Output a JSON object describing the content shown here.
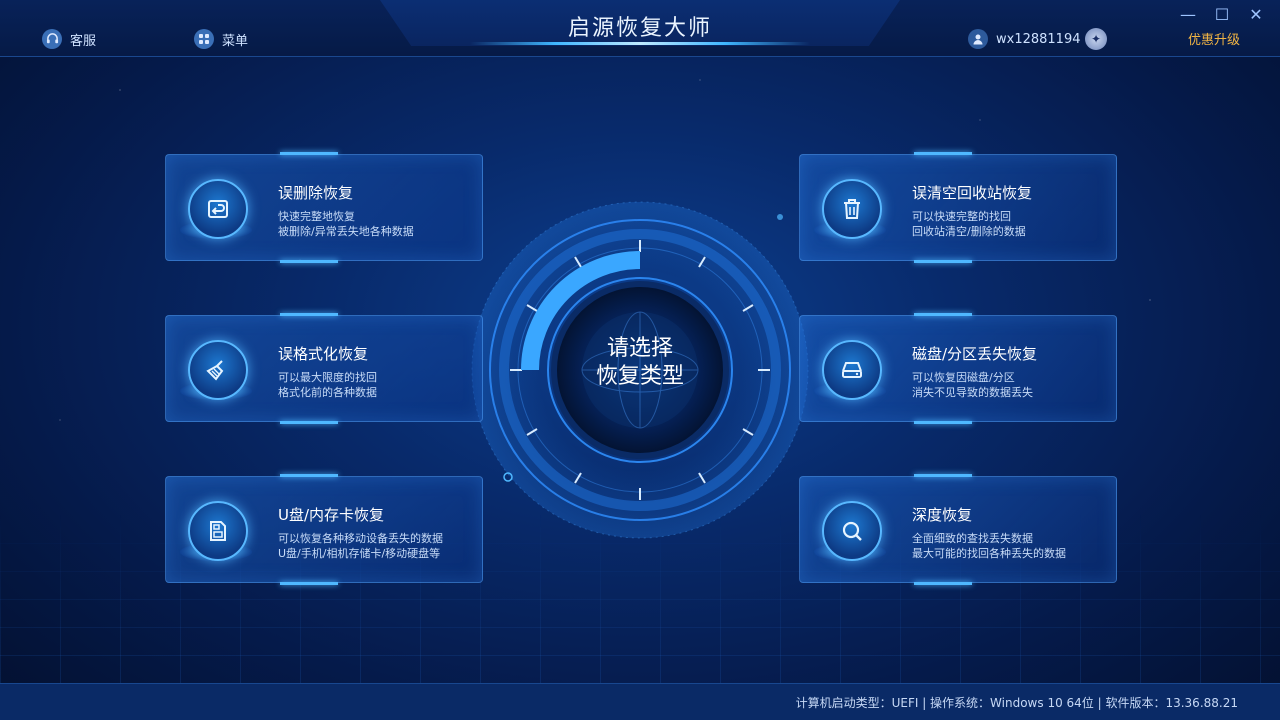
{
  "window": {
    "title": "启源恢复大师",
    "controls": [
      "minimize",
      "maximize",
      "close"
    ]
  },
  "toolbar": {
    "support_label": "客服",
    "menu_label": "菜单",
    "username": "wx12881194",
    "upgrade_label": "优惠升级"
  },
  "center": {
    "line1": "请选择",
    "line2": "恢复类型",
    "progress_fraction": 0.25
  },
  "cards": [
    {
      "title": "误删除恢复",
      "desc1": "快速完整地恢复",
      "desc2": "被删除/异常丢失地各种数据",
      "icon": "restore-file-icon"
    },
    {
      "title": "误清空回收站恢复",
      "desc1": "可以快速完整的找回",
      "desc2": "回收站清空/删除的数据",
      "icon": "trash-bin-icon"
    },
    {
      "title": "误格式化恢复",
      "desc1": "可以最大限度的找回",
      "desc2": "格式化前的各种数据",
      "icon": "broom-icon"
    },
    {
      "title": "磁盘/分区丢失恢复",
      "desc1": "可以恢复因磁盘/分区",
      "desc2": "消失不见导致的数据丢失",
      "icon": "hard-disk-icon"
    },
    {
      "title": "U盘/内存卡恢复",
      "desc1": "可以恢复各种移动设备丢失的数据",
      "desc2": "U盘/手机/相机存储卡/移动硬盘等",
      "icon": "memory-card-icon"
    },
    {
      "title": "深度恢复",
      "desc1": "全面细致的查找丢失数据",
      "desc2": "最大可能的找回各种丢失的数据",
      "icon": "magnifier-icon"
    }
  ],
  "status": {
    "text": "计算机启动类型：UEFI | 操作系统：Windows 10 64位 | 软件版本：13.36.88.21"
  },
  "colors": {
    "accent": "#4fb8ff",
    "upgrade": "#f2b544",
    "background": "#082a6b"
  }
}
